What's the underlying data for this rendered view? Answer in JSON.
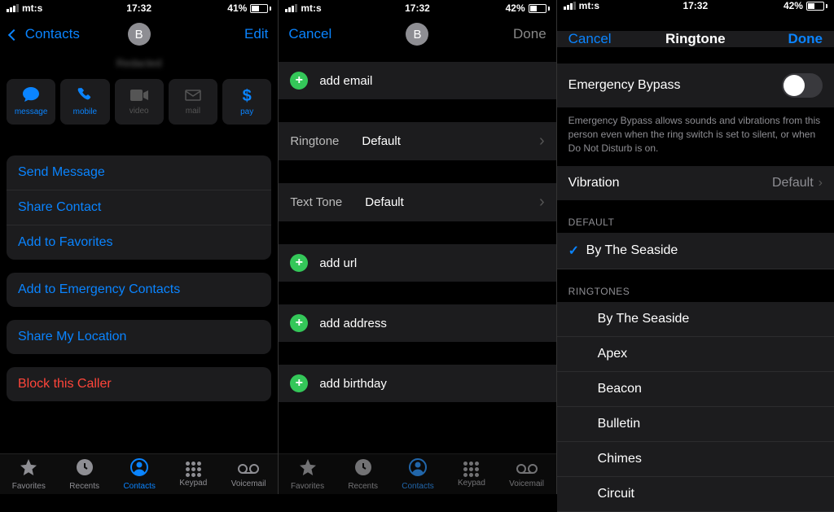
{
  "status": {
    "carrier": "mt:s",
    "time": "17:32"
  },
  "panel1": {
    "battery": "41%",
    "battery_fill": 41,
    "back": "Contacts",
    "edit": "Edit",
    "avatar_initial": "B",
    "contact_name": "Redacted",
    "actions": [
      {
        "key": "message",
        "label": "message",
        "enabled": true
      },
      {
        "key": "mobile",
        "label": "mobile",
        "enabled": true
      },
      {
        "key": "video",
        "label": "video",
        "enabled": false
      },
      {
        "key": "mail",
        "label": "mail",
        "enabled": false
      },
      {
        "key": "pay",
        "label": "pay",
        "enabled": true
      }
    ],
    "rows1": [
      "Send Message",
      "Share Contact",
      "Add to Favorites"
    ],
    "rows2": [
      "Add to Emergency Contacts"
    ],
    "rows3": [
      "Share My Location"
    ],
    "rows4": [
      "Block this Caller"
    ]
  },
  "panel2": {
    "battery": "42%",
    "battery_fill": 42,
    "cancel": "Cancel",
    "done": "Done",
    "avatar_initial": "B",
    "add_email": "add email",
    "ringtone_label": "Ringtone",
    "ringtone_value": "Default",
    "texttone_label": "Text Tone",
    "texttone_value": "Default",
    "add_url": "add url",
    "add_address": "add address",
    "add_birthday": "add birthday"
  },
  "panel3": {
    "battery": "42%",
    "battery_fill": 42,
    "cancel": "Cancel",
    "title": "Ringtone",
    "done": "Done",
    "bypass_label": "Emergency Bypass",
    "bypass_on": false,
    "bypass_hint": "Emergency Bypass allows sounds and vibrations from this person even when the ring switch is set to silent, or when Do Not Disturb is on.",
    "vibration_label": "Vibration",
    "vibration_value": "Default",
    "section_default": "DEFAULT",
    "default_selected": "By The Seaside",
    "section_ringtones": "RINGTONES",
    "ringtones": [
      "By The Seaside",
      "Apex",
      "Beacon",
      "Bulletin",
      "Chimes",
      "Circuit"
    ]
  },
  "tabs": [
    {
      "key": "favorites",
      "label": "Favorites"
    },
    {
      "key": "recents",
      "label": "Recents"
    },
    {
      "key": "contacts",
      "label": "Contacts"
    },
    {
      "key": "keypad",
      "label": "Keypad"
    },
    {
      "key": "voicemail",
      "label": "Voicemail"
    }
  ],
  "active_tab": "contacts"
}
